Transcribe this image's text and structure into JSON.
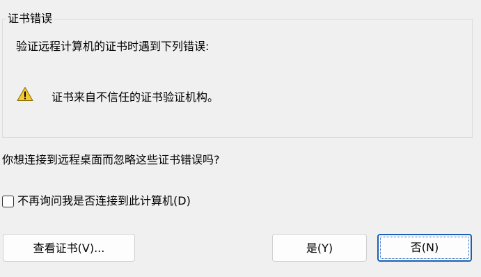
{
  "group": {
    "legend": "证书错误",
    "intro": "验证远程计算机的证书时遇到下列错误:",
    "errors": [
      {
        "icon": "warning-icon",
        "text": "证书来自不信任的证书验证机构。"
      }
    ]
  },
  "question": "你想连接到远程桌面而忽略这些证书错误吗?",
  "checkbox": {
    "label": "不再询问我是否连接到此计算机(D)",
    "checked": false
  },
  "buttons": {
    "view_cert": "查看证书(V)...",
    "yes": "是(Y)",
    "no": "否(N)"
  },
  "colors": {
    "background": "#f0f0f0",
    "warning_fill": "#f3c832",
    "focus_border": "#1a5fb4"
  }
}
